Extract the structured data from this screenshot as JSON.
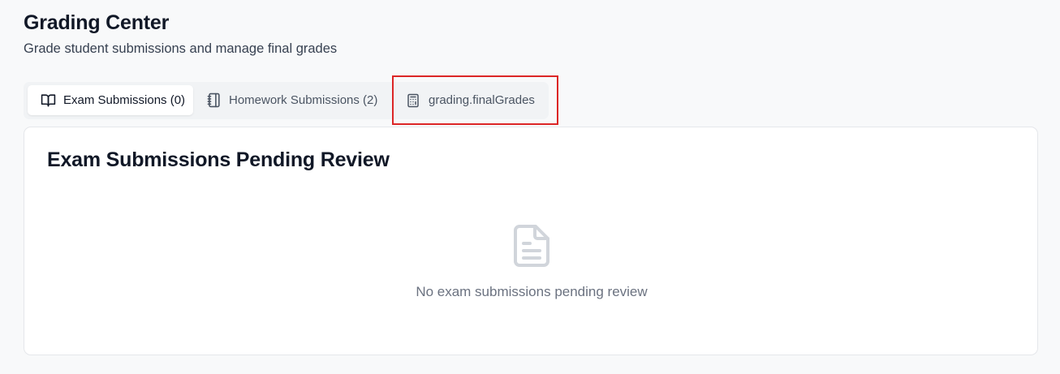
{
  "header": {
    "title": "Grading Center",
    "subtitle": "Grade student submissions and manage final grades"
  },
  "tabs": [
    {
      "label": "Exam Submissions (0)",
      "icon": "book-open-icon",
      "active": true
    },
    {
      "label": "Homework Submissions (2)",
      "icon": "notebook-icon",
      "active": false
    },
    {
      "label": "grading.finalGrades",
      "icon": "calculator-icon",
      "active": false
    }
  ],
  "panel": {
    "title": "Exam Submissions Pending Review",
    "empty_icon": "file-text-icon",
    "empty_message": "No exam submissions pending review"
  },
  "colors": {
    "highlight": "#dc2626",
    "page_background": "#f8f9fa",
    "tab_bar_background": "#f1f3f5",
    "card_background": "#ffffff",
    "muted_text": "#6b7280"
  }
}
